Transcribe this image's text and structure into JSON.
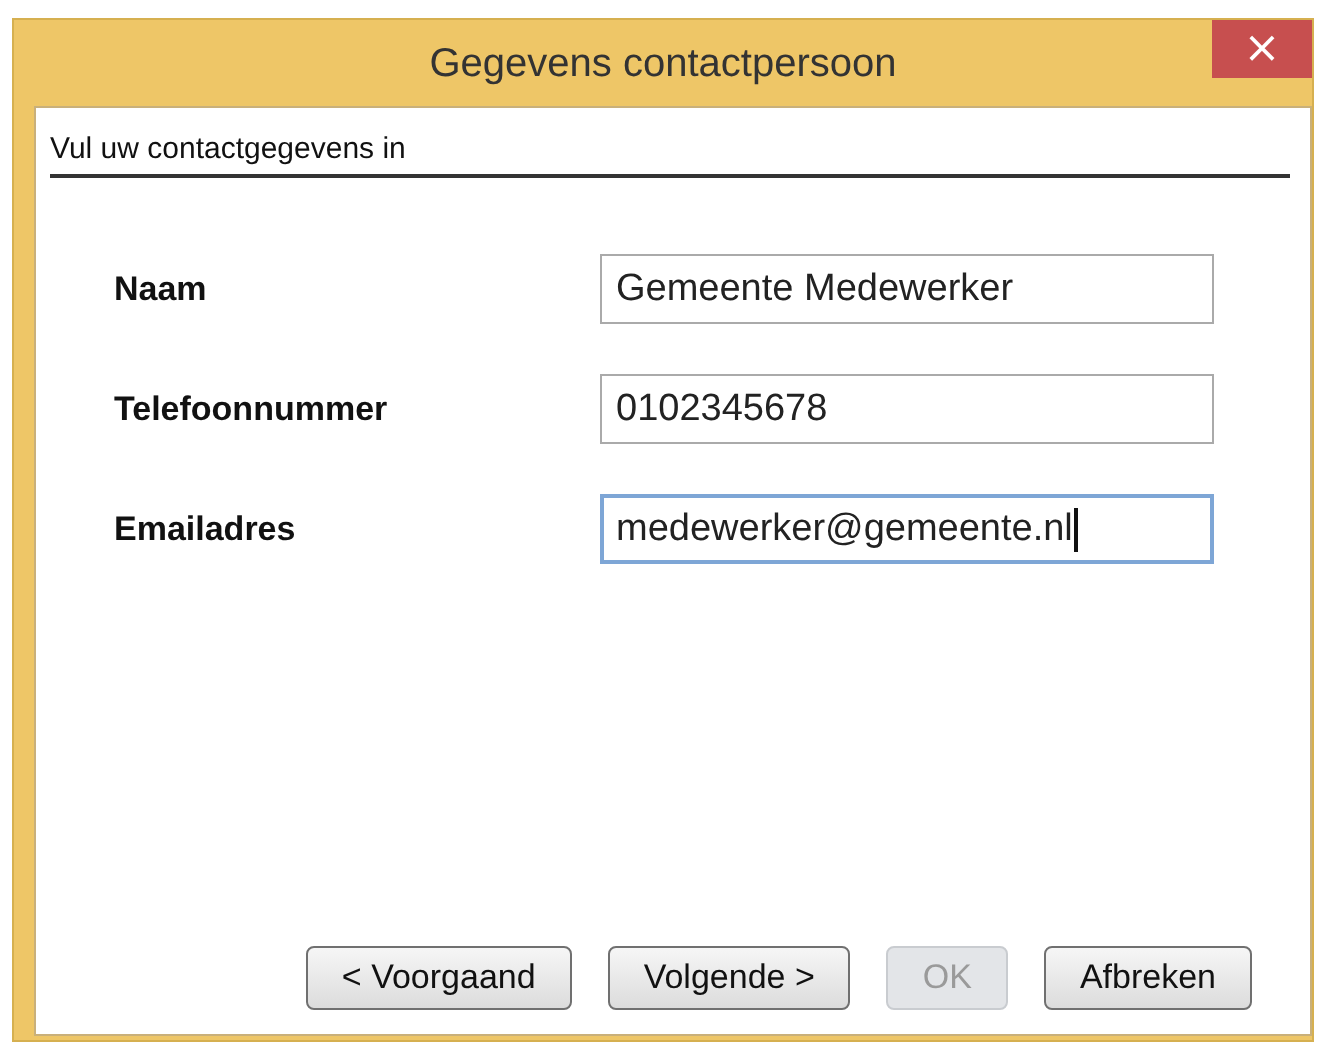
{
  "window": {
    "title": "Gegevens contactpersoon",
    "close": "×"
  },
  "heading": "Vul uw contactgegevens in",
  "fields": [
    {
      "label": "Naam",
      "value": "Gemeente Medewerker",
      "focused": false
    },
    {
      "label": "Telefoonnummer",
      "value": "0102345678",
      "focused": false
    },
    {
      "label": "Emailadres",
      "value": "medewerker@gemeente.nl",
      "focused": true
    }
  ],
  "buttons": [
    {
      "label": "< Voorgaand",
      "disabled": false
    },
    {
      "label": "Volgende >",
      "disabled": false
    },
    {
      "label": "OK",
      "disabled": true
    },
    {
      "label": "Afbreken",
      "disabled": false
    }
  ]
}
